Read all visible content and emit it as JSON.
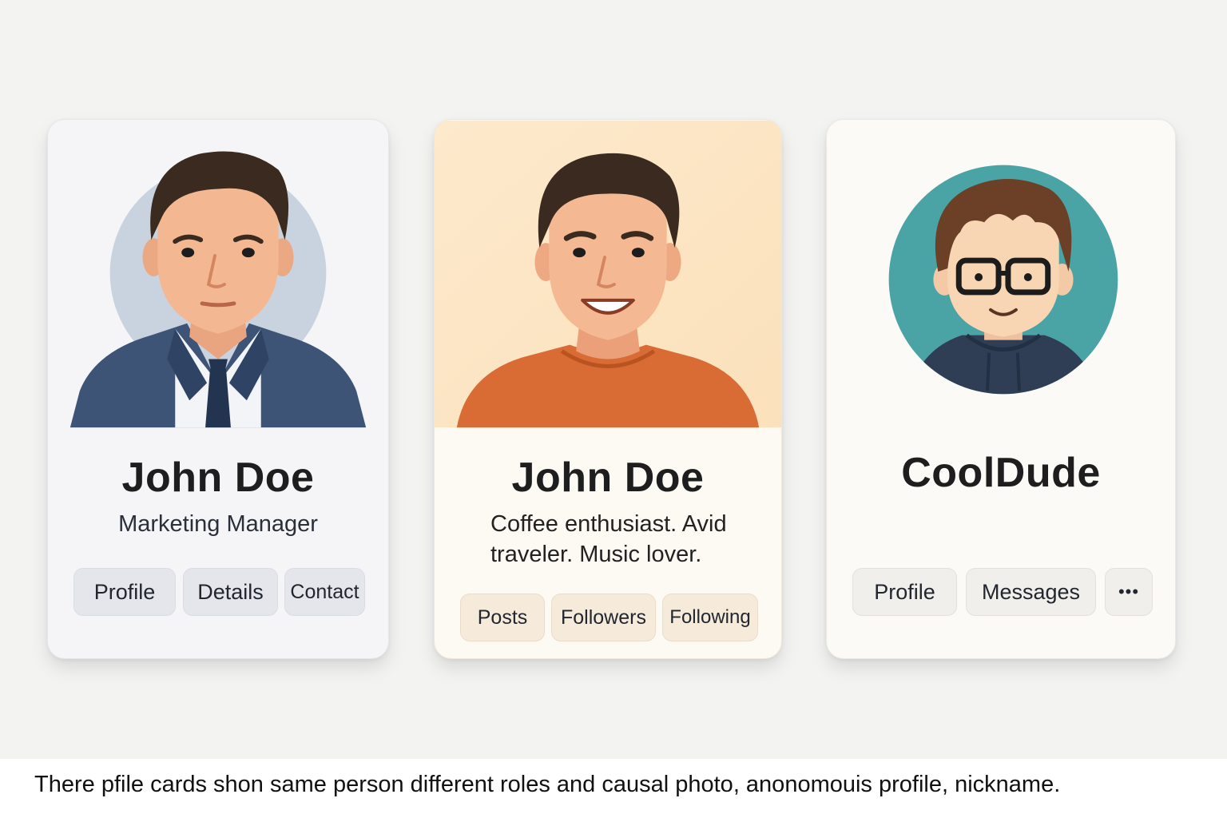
{
  "cards": [
    {
      "name": "John Doe",
      "subtitle": "Marketing Manager",
      "buttons": [
        "Profile",
        "Details",
        "Contact"
      ],
      "photo_background": "#c9d3df",
      "accent": "#3d5476"
    },
    {
      "name": "John Doe",
      "bio_line1": "Coffee enthusiast. Avid",
      "bio_line2": "traveler. Music lover.",
      "buttons": [
        "Posts",
        "Followers",
        "Following"
      ],
      "photo_background": "#fde8c8",
      "accent": "#d96b34"
    },
    {
      "name": "CoolDude",
      "buttons": [
        "Profile",
        "Messages",
        "•••"
      ],
      "avatar_background": "#4aa3a5",
      "accent": "#2f3e55"
    }
  ],
  "caption": "There pfile cards shon same person different roles and causal photo, anonomouis profile, nickname."
}
